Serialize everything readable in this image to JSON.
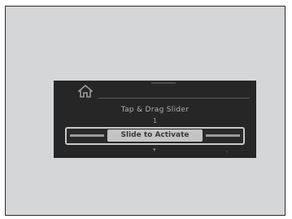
{
  "screen": {
    "prompt": "Tap & Drag Slider",
    "step": "1",
    "slider_label": "Slide to Activate"
  },
  "icons": {
    "home": "home-icon"
  },
  "colors": {
    "frame_bg": "#d5d6d8",
    "screen_bg": "#262626",
    "slider_border": "#c8c8c8",
    "knob": "#c4c4c4"
  }
}
